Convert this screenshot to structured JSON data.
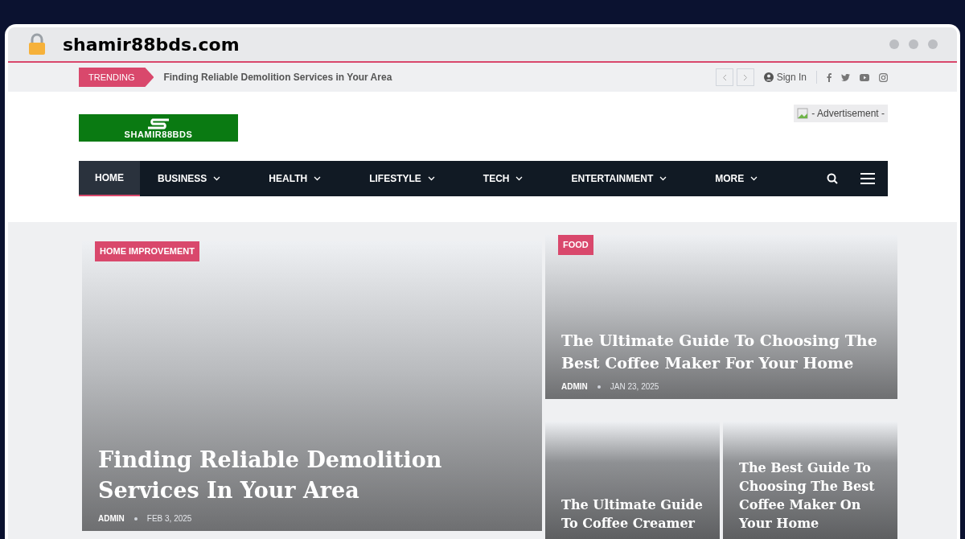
{
  "browser": {
    "url": "shamir88bds.com"
  },
  "topbar": {
    "trending_label": "TRENDING",
    "trending_text": "Finding Reliable Demolition Services in Your Area",
    "sign_in": "Sign In"
  },
  "header": {
    "logo_text": "SHAMIR88BDS",
    "ad_text": "- Advertisement -"
  },
  "nav": [
    {
      "label": "HOME",
      "selected": true,
      "dropdown": false
    },
    {
      "label": "BUSINESS",
      "selected": false,
      "dropdown": true
    },
    {
      "label": "HEALTH",
      "selected": false,
      "dropdown": true
    },
    {
      "label": "LIFESTYLE",
      "selected": false,
      "dropdown": true
    },
    {
      "label": "TECH",
      "selected": false,
      "dropdown": true
    },
    {
      "label": "ENTERTAINMENT",
      "selected": false,
      "dropdown": true
    },
    {
      "label": "MORE",
      "selected": false,
      "dropdown": true
    }
  ],
  "featured": [
    {
      "category": "HOME IMPROVEMENT",
      "title": "Finding Reliable Demolition Services In Your Area",
      "author": "ADMIN",
      "date": "FEB 3, 2025"
    },
    {
      "category": "FOOD",
      "title": "The Ultimate Guide To Choosing The Best Coffee Maker For Your Home",
      "author": "ADMIN",
      "date": "JAN 23, 2025"
    },
    {
      "title": "The Ultimate Guide To Coffee Creamer"
    },
    {
      "title": "The Best Guide To Choosing The Best Coffee Maker On Your Home"
    }
  ]
}
